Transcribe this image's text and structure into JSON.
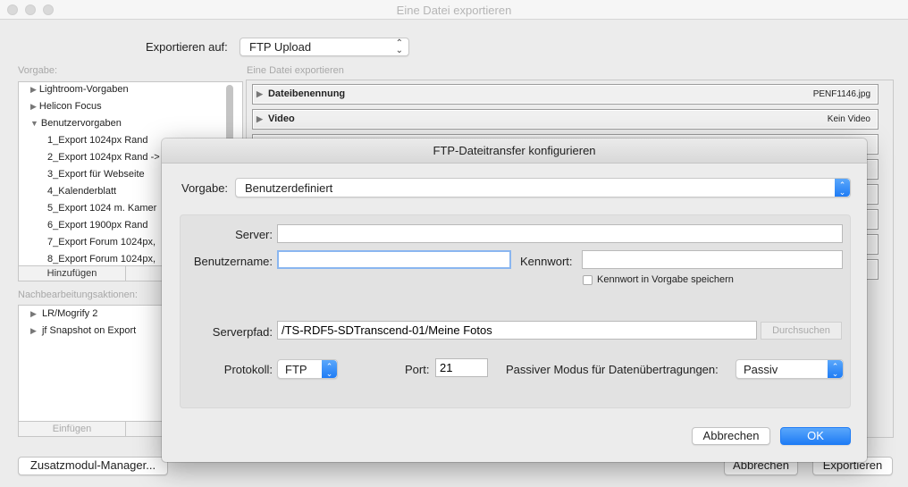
{
  "window": {
    "title": "Eine Datei exportieren"
  },
  "export_to": {
    "label": "Exportieren auf:",
    "value": "FTP Upload"
  },
  "presets": {
    "label": "Vorgabe:",
    "items": [
      {
        "label": "Lightroom-Vorgaben",
        "level": 0,
        "expanded": false
      },
      {
        "label": "Helicon Focus",
        "level": 0,
        "expanded": false
      },
      {
        "label": "Benutzervorgaben",
        "level": 0,
        "expanded": true
      },
      {
        "label": "1_Export 1024px Rand",
        "level": 1
      },
      {
        "label": "2_Export 1024px Rand ->",
        "level": 1
      },
      {
        "label": "3_Export für Webseite",
        "level": 1
      },
      {
        "label": "4_Kalenderblatt",
        "level": 1
      },
      {
        "label": "5_Export 1024 m. Kamer",
        "level": 1
      },
      {
        "label": "6_Export 1900px Rand",
        "level": 1
      },
      {
        "label": "7_Export Forum 1024px,",
        "level": 1
      },
      {
        "label": "8_Export Forum 1024px,",
        "level": 1
      }
    ],
    "add_label": "Hinzufügen"
  },
  "post_actions": {
    "label": "Nachbearbeitungsaktionen:",
    "items": [
      "LR/Mogrify 2",
      "jf Snapshot on Export"
    ],
    "insert_label": "Einfügen"
  },
  "plugin_manager_label": "Zusatzmodul-Manager...",
  "right_panel": {
    "label": "Eine Datei exportieren",
    "sections": [
      {
        "title": "Dateibenennung",
        "value": "PENF1146.jpg"
      },
      {
        "title": "Video",
        "value": "Kein Video"
      }
    ]
  },
  "main_buttons": {
    "cancel": "Abbrechen",
    "export": "Exportieren"
  },
  "ftp_dialog": {
    "title": "FTP-Dateitransfer konfigurieren",
    "preset_label": "Vorgabe:",
    "preset_value": "Benutzerdefiniert",
    "server_label": "Server:",
    "server_value": "",
    "username_label": "Benutzername:",
    "username_value": "",
    "password_label": "Kennwort:",
    "password_value": "",
    "save_password_label": "Kennwort in Vorgabe speichern",
    "save_password_checked": false,
    "path_label": "Serverpfad:",
    "path_value": "/TS-RDF5-SDTranscend-01/Meine Fotos",
    "browse_label": "Durchsuchen",
    "protocol_label": "Protokoll:",
    "protocol_value": "FTP",
    "port_label": "Port:",
    "port_value": "21",
    "passive_label": "Passiver Modus für Datenübertragungen:",
    "passive_value": "Passiv",
    "cancel_label": "Abbrechen",
    "ok_label": "OK",
    "accent": "#1f7cf5"
  }
}
